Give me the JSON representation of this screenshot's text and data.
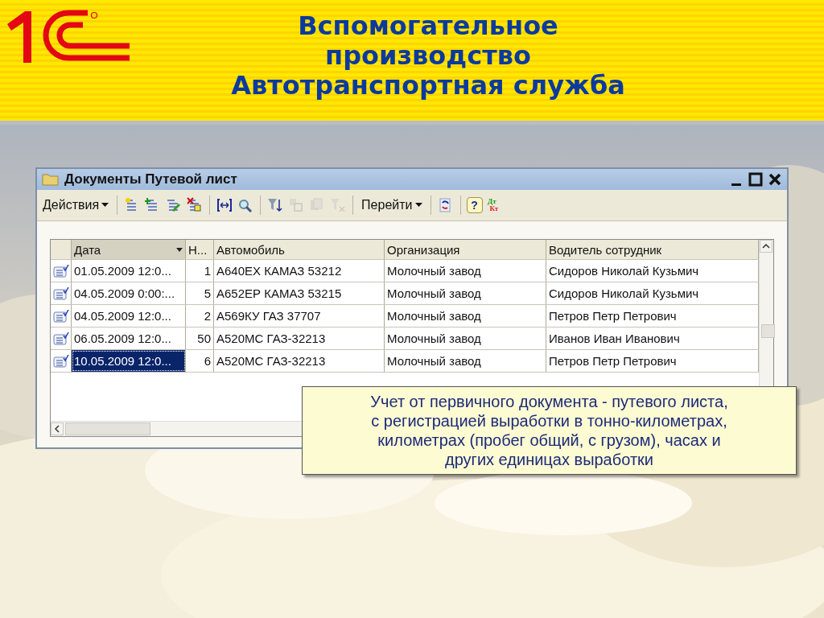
{
  "slide": {
    "title_lines": [
      "Вспомогательное",
      "производство",
      "Автотранспортная служба"
    ]
  },
  "window": {
    "title": "Документы Путевой лист",
    "toolbar": [
      {
        "kind": "menu",
        "label": "Действия"
      },
      {
        "kind": "separator"
      },
      {
        "kind": "icon",
        "disabled": false
      },
      {
        "kind": "icon",
        "disabled": false
      },
      {
        "kind": "icon",
        "disabled": false
      },
      {
        "kind": "icon",
        "disabled": false
      },
      {
        "kind": "separator"
      },
      {
        "kind": "icon",
        "disabled": false
      },
      {
        "kind": "icon",
        "disabled": false
      },
      {
        "kind": "separator"
      },
      {
        "kind": "icon",
        "disabled": false
      },
      {
        "kind": "icon",
        "disabled": true
      },
      {
        "kind": "icon",
        "disabled": true
      },
      {
        "kind": "icon",
        "disabled": true
      },
      {
        "kind": "separator"
      },
      {
        "kind": "menu",
        "label": "Перейти"
      },
      {
        "kind": "separator"
      },
      {
        "kind": "icon",
        "disabled": false
      },
      {
        "kind": "separator"
      },
      {
        "kind": "help",
        "label": "?"
      },
      {
        "kind": "dtkt",
        "top": "Дт",
        "bottom": "Кт"
      }
    ],
    "table": {
      "columns": [
        {
          "label": "Дата",
          "sorted": true
        },
        {
          "label": "Н...",
          "sorted": false
        },
        {
          "label": "Автомобиль",
          "sorted": false
        },
        {
          "label": "Организация",
          "sorted": false
        },
        {
          "label": "Водитель сотрудник",
          "sorted": false
        }
      ],
      "rows": [
        {
          "selected": false,
          "cells": [
            "01.05.2009 12:0...",
            "1",
            "А640ЕХ КАМАЗ 53212",
            "Молочный завод",
            "Сидоров Николай Кузьмич"
          ]
        },
        {
          "selected": false,
          "cells": [
            "04.05.2009 0:00:...",
            "5",
            "А652ЕР КАМАЗ 53215",
            "Молочный завод",
            "Сидоров Николай Кузьмич"
          ]
        },
        {
          "selected": false,
          "cells": [
            "04.05.2009 12:0...",
            "2",
            "А569КУ ГАЗ 37707",
            "Молочный завод",
            "Петров Петр Петрович"
          ]
        },
        {
          "selected": false,
          "cells": [
            "06.05.2009 12:0...",
            "50",
            "А520МС ГАЗ-32213",
            "Молочный завод",
            "Иванов Иван Иванович"
          ]
        },
        {
          "selected": true,
          "cells": [
            "10.05.2009 12:0...",
            "6",
            "А520МС ГАЗ-32213",
            "Молочный завод",
            "Петров Петр Петрович"
          ]
        }
      ]
    }
  },
  "callout": {
    "lines": [
      "Учет от первичного документа - путевого листа,",
      "с регистрацией выработки в тонно-километрах,",
      "километрах (пробег общий, с грузом), часах и",
      "других единицах выработки"
    ]
  }
}
